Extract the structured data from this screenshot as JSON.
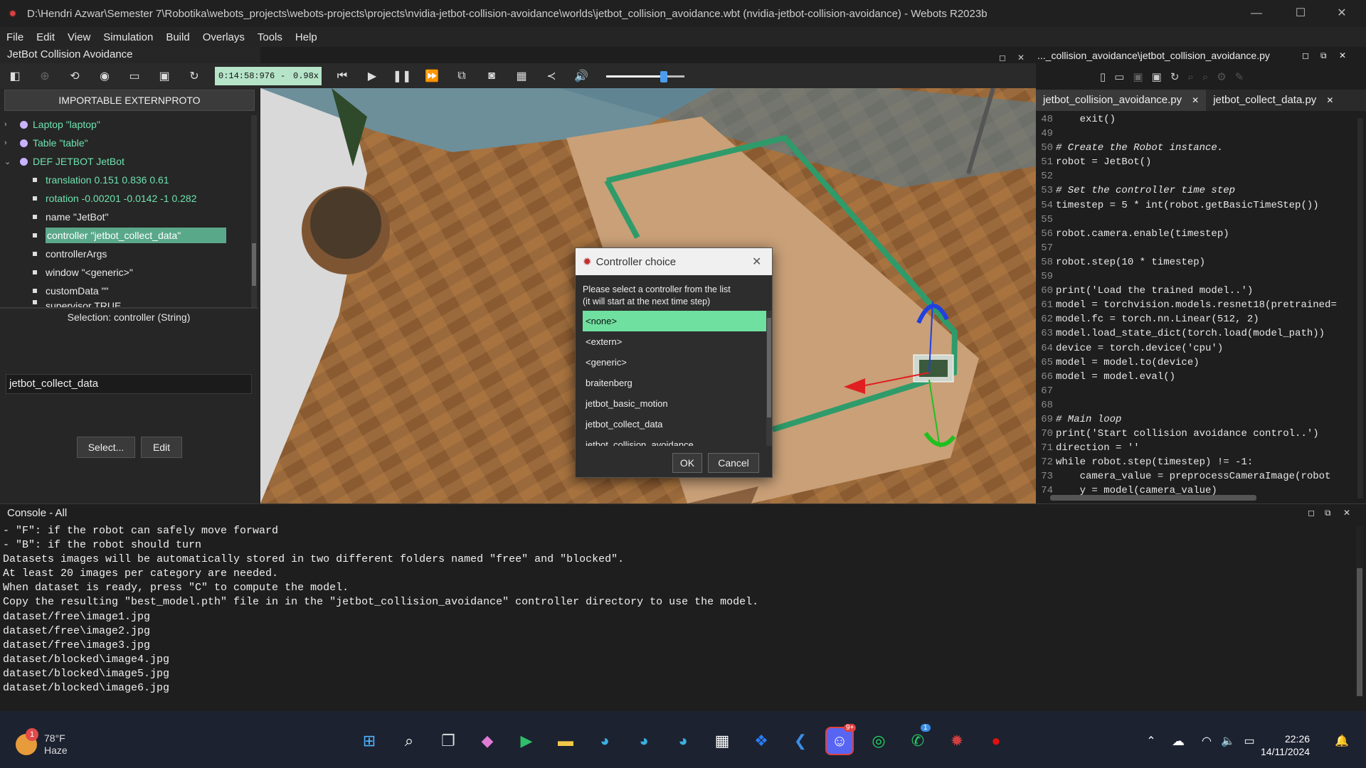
{
  "window": {
    "title": "D:\\Hendri Azwar\\Semester 7\\Robotika\\webots_projects\\webots-projects\\projects\\nvidia-jetbot-collision-avoidance\\worlds\\jetbot_collision_avoidance.wbt (nvidia-jetbot-collision-avoidance) - Webots R2023b"
  },
  "menu": [
    "File",
    "Edit",
    "View",
    "Simulation",
    "Build",
    "Overlays",
    "Tools",
    "Help"
  ],
  "scene_panel": {
    "title": "JetBot Collision Avoidance",
    "extern_button": "IMPORTABLE EXTERNPROTO",
    "tree": [
      {
        "label": "Laptop \"laptop\"",
        "type": "node"
      },
      {
        "label": "Table \"table\"",
        "type": "node"
      },
      {
        "label": "DEF JETBOT JetBot",
        "type": "node-open"
      },
      {
        "label": "translation 0.151 0.836 0.61",
        "type": "field-green"
      },
      {
        "label": "rotation -0.00201 -0.0142 -1 0.282",
        "type": "field-green"
      },
      {
        "label": "name \"JetBot\"",
        "type": "field"
      },
      {
        "label": "controller \"jetbot_collect_data\"",
        "type": "field-selected"
      },
      {
        "label": "controllerArgs",
        "type": "field"
      },
      {
        "label": "window \"<generic>\"",
        "type": "field"
      },
      {
        "label": "customData \"\"",
        "type": "field"
      },
      {
        "label": "supervisor TRUE",
        "type": "field"
      }
    ],
    "selection_label": "Selection: controller (String)",
    "field_value": "jetbot_collect_data",
    "select_button": "Select...",
    "edit_button": "Edit"
  },
  "toolbar": {
    "time": "0:14:58:976",
    "separator": "-",
    "speed": "0.98x",
    "volume": 0.74
  },
  "editor": {
    "title": "..._collision_avoidance\\jetbot_collision_avoidance.py",
    "tabs": [
      "jetbot_collision_avoidance.py",
      "jetbot_collect_data.py"
    ],
    "lines": [
      {
        "n": "48",
        "t": "    exit()"
      },
      {
        "n": "49",
        "t": ""
      },
      {
        "n": "50",
        "t": "# Create the Robot instance.",
        "c": "cm"
      },
      {
        "n": "51",
        "t": "robot = JetBot()"
      },
      {
        "n": "52",
        "t": ""
      },
      {
        "n": "53",
        "t": "# Set the controller time step",
        "c": "cm"
      },
      {
        "n": "54",
        "t": "timestep = 5 * int(robot.getBasicTimeStep())"
      },
      {
        "n": "55",
        "t": ""
      },
      {
        "n": "56",
        "t": "robot.camera.enable(timestep)"
      },
      {
        "n": "57",
        "t": ""
      },
      {
        "n": "58",
        "t": "robot.step(10 * timestep)"
      },
      {
        "n": "59",
        "t": ""
      },
      {
        "n": "60",
        "t": "print('Load the trained model..')"
      },
      {
        "n": "61",
        "t": "model = torchvision.models.resnet18(pretrained="
      },
      {
        "n": "62",
        "t": "model.fc = torch.nn.Linear(512, 2)"
      },
      {
        "n": "63",
        "t": "model.load_state_dict(torch.load(model_path))"
      },
      {
        "n": "64",
        "t": "device = torch.device('cpu')"
      },
      {
        "n": "65",
        "t": "model = model.to(device)"
      },
      {
        "n": "66",
        "t": "model = model.eval()"
      },
      {
        "n": "67",
        "t": ""
      },
      {
        "n": "68",
        "t": ""
      },
      {
        "n": "69",
        "t": "# Main loop",
        "c": "cm"
      },
      {
        "n": "70",
        "t": "print('Start collision avoidance control..')"
      },
      {
        "n": "71",
        "t": "direction = ''"
      },
      {
        "n": "72",
        "t": "while robot.step(timestep) != -1:"
      },
      {
        "n": "73",
        "t": "    camera_value = preprocessCameraImage(robot"
      },
      {
        "n": "74",
        "t": "    y = model(camera_value)"
      }
    ]
  },
  "console": {
    "title": "Console - All",
    "lines": [
      "- \"F\": if the robot can safely move forward",
      "- \"B\": if the robot should turn",
      "Datasets images will be automatically stored in two different folders named \"free\" and \"blocked\".",
      "At least 20 images per category are needed.",
      "When dataset is ready, press \"C\" to compute the model.",
      "Copy the resulting \"best_model.pth\" file in in the \"jetbot_collision_avoidance\" controller directory to use the model.",
      "dataset/free\\image1.jpg",
      "dataset/free\\image2.jpg",
      "dataset/free\\image3.jpg",
      "dataset/blocked\\image4.jpg",
      "dataset/blocked\\image5.jpg",
      "dataset/blocked\\image6.jpg"
    ]
  },
  "dialog": {
    "title": "Controller choice",
    "message_line1": "Please select a controller from the list",
    "message_line2": "(it will start at the next time step)",
    "options": [
      "<none>",
      "<extern>",
      "<generic>",
      "braitenberg",
      "jetbot_basic_motion",
      "jetbot_collect_data",
      "jetbot_collision_avoidance"
    ],
    "selected": "<none>",
    "ok": "OK",
    "cancel": "Cancel"
  },
  "taskbar": {
    "weather_badge": "1",
    "temperature": "78°F",
    "condition": "Haze",
    "discord_badge": "9+",
    "whatsapp_badge": "1",
    "time": "22:26",
    "date": "14/11/2024"
  }
}
